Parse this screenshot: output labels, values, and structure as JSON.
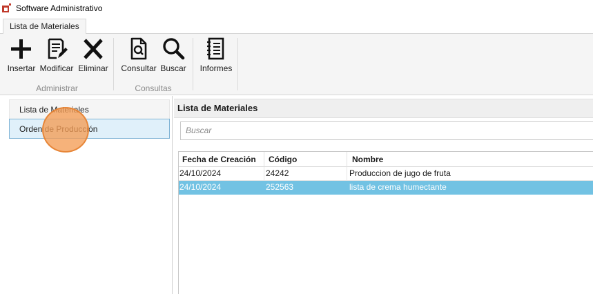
{
  "window": {
    "title": "Software Administrativo"
  },
  "ribbon": {
    "tab": "Lista de Materiales",
    "groups": [
      {
        "label": "Administrar",
        "buttons": [
          {
            "label": "Insertar",
            "icon": "plus-icon"
          },
          {
            "label": "Modificar",
            "icon": "edit-document-icon"
          },
          {
            "label": "Eliminar",
            "icon": "x-close-icon"
          }
        ]
      },
      {
        "label": "Consultas",
        "buttons": [
          {
            "label": "Consultar",
            "icon": "document-search-icon"
          },
          {
            "label": "Buscar",
            "icon": "magnifier-icon"
          }
        ]
      },
      {
        "label": "",
        "buttons": [
          {
            "label": "Informes",
            "icon": "notebook-icon"
          }
        ]
      }
    ]
  },
  "nav": {
    "items": [
      {
        "label": "Lista de Materiales"
      },
      {
        "label": "Orden de Producción"
      }
    ]
  },
  "main": {
    "header": "Lista de Materiales",
    "search_placeholder": "Buscar",
    "columns": [
      "Fecha de Creación",
      "Código",
      "Nombre"
    ],
    "rows": [
      {
        "fecha": "24/10/2024",
        "codigo": "24242",
        "nombre": "Produccion de  jugo de fruta"
      },
      {
        "fecha": "24/10/2024",
        "codigo": "252563",
        "nombre": "lista de crema humectante"
      }
    ]
  },
  "colors": {
    "selection": "#72c2e3",
    "nav_selected": "#e0f0fa",
    "cursor_highlight": "#f49c54"
  }
}
